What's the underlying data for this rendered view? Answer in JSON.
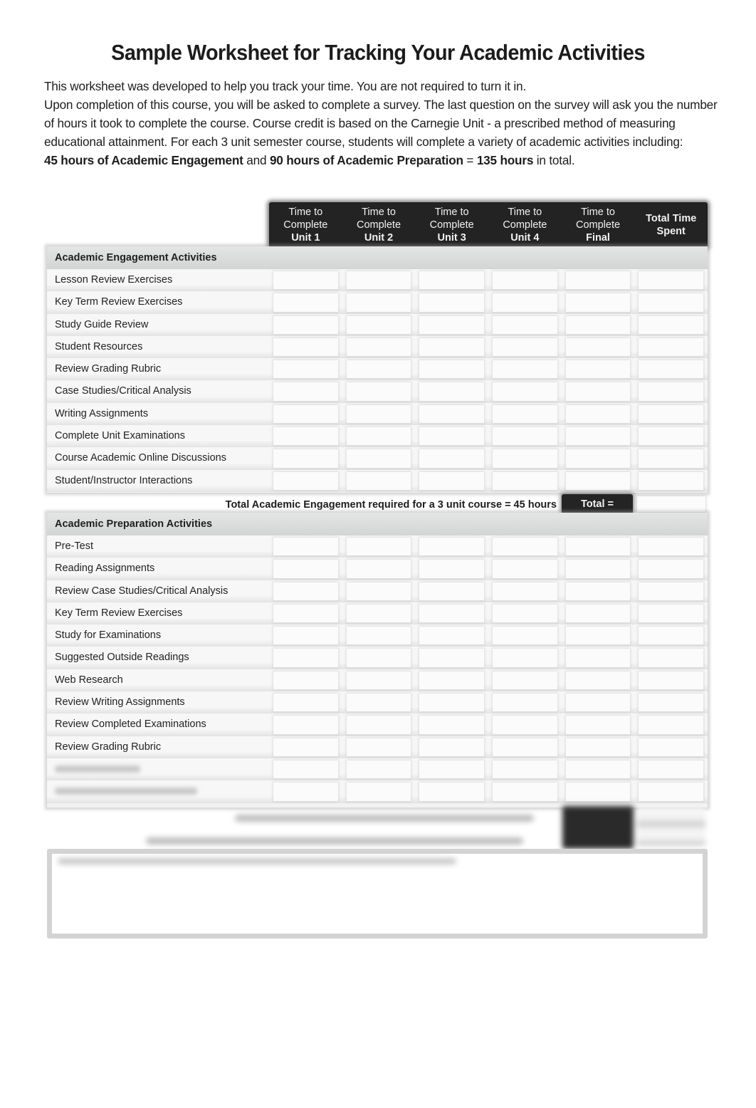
{
  "title": "Sample Worksheet for Tracking Your Academic Activities",
  "intro": {
    "line1": "This worksheet was developed to help you track your time. You are not required to turn it in.",
    "line2": "Upon completion of this course, you will be asked to complete a survey. The last question on the survey will ask you the number of hours it took to complete the course. Course credit is based on the Carnegie Unit - a prescribed method of measuring educational attainment. For each 3 unit semester course, students will complete a variety of academic activities including:",
    "summary": {
      "engagement": "45 hours of Academic Engagement",
      "and": " and ",
      "preparation": "90 hours of Academic Preparation",
      "equals": " = ",
      "total": "135 hours",
      "suffix": " in total."
    }
  },
  "columns": [
    {
      "line1": "Time to",
      "line2": "Complete",
      "line3": "Unit 1"
    },
    {
      "line1": "Time to",
      "line2": "Complete",
      "line3": "Unit 2"
    },
    {
      "line1": "Time to",
      "line2": "Complete",
      "line3": "Unit 3"
    },
    {
      "line1": "Time to",
      "line2": "Complete",
      "line3": "Unit 4"
    },
    {
      "line1": "Time to",
      "line2": "Complete",
      "line3": "Final"
    },
    {
      "line1": "Total Time",
      "line2": "Spent",
      "line3": ""
    }
  ],
  "engagement": {
    "heading": "Academic Engagement Activities",
    "rows": [
      "Lesson Review Exercises",
      "Key Term Review Exercises",
      "Study Guide Review",
      "Student Resources",
      "Review Grading Rubric",
      "Case Studies/Critical Analysis",
      "Writing Assignments",
      "Complete Unit Examinations",
      "Course Academic Online Discussions",
      "Student/Instructor Interactions"
    ],
    "total_text": "Total Academic Engagement required for a 3 unit course = 45 hours",
    "total_label": "Total ="
  },
  "preparation": {
    "heading": "Academic Preparation Activities",
    "rows": [
      "Pre-Test",
      "Reading Assignments",
      "Review Case Studies/Critical Analysis",
      "Key Term Review Exercises",
      "Study for Examinations",
      "Suggested Outside Readings",
      "Web Research",
      "Review Writing Assignments",
      "Review Completed Examinations",
      "Review Grading Rubric"
    ],
    "blurred_rows": 2
  }
}
